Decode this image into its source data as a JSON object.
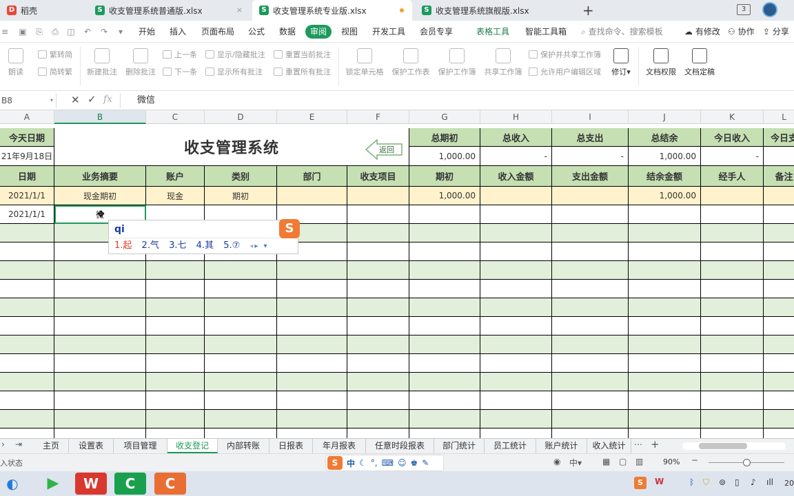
{
  "tabs": {
    "home": "稻壳",
    "file1": "收支管理系统普通版.xlsx",
    "file2": "收支管理系统专业版.xlsx",
    "file3": "收支管理系统旗舰版.xlsx",
    "new_tab": "+",
    "window_count": "3"
  },
  "menu": {
    "items": [
      "开始",
      "插入",
      "页面布局",
      "公式",
      "数据",
      "审阅",
      "视图",
      "开发工具",
      "会员专享",
      "表格工具",
      "智能工具箱"
    ],
    "search": "查找命令、搜索模板",
    "edits": "有修改",
    "collab": "协作",
    "share": "分享"
  },
  "ribbon": {
    "read_aloud": "朗读",
    "trad_to_simp": "繁转简",
    "simp_to_trad": "简转繁",
    "new_comment": "新建批注",
    "delete_comment": "删除批注",
    "prev": "上一条",
    "next": "下一条",
    "toggle_comments": "显示/隐藏批注",
    "show_all_comments": "显示所有批注",
    "reset_current": "重置当前批注",
    "reset_all": "重置所有批注",
    "lock_cell": "锁定单元格",
    "protect_sheet": "保护工作表",
    "protect_book": "保护工作簿",
    "share_book": "共享工作簿",
    "protect_share": "保护并共享工作簿",
    "allow_edit": "允许用户编辑区域",
    "track": "修订",
    "doc_perm": "文档权限",
    "doc_final": "文档定稿"
  },
  "formula": {
    "cell_ref": "B8",
    "content": "微信"
  },
  "columns": [
    "A",
    "B",
    "C",
    "D",
    "E",
    "F",
    "G",
    "H",
    "I",
    "J",
    "K",
    "L"
  ],
  "sheet": {
    "today_label": "今天日期",
    "today_value": "21年9月18日",
    "title": "收支管理系统",
    "back_button": "返回",
    "summary_labels": [
      "总期初",
      "总收入",
      "总支出",
      "总结余",
      "今日收入",
      "今日支"
    ],
    "summary_values": [
      "1,000.00",
      "-",
      "-",
      "1,000.00",
      "-",
      ""
    ],
    "headers": [
      "日期",
      "业务摘要",
      "账户",
      "类别",
      "部门",
      "收支项目",
      "期初",
      "收入金额",
      "支出金额",
      "结余金额",
      "经手人",
      "备注"
    ],
    "row1": [
      "2021/1/1",
      "现金期初",
      "现金",
      "期初",
      "",
      "",
      "1,000.00",
      "",
      "",
      "1,000.00",
      "",
      ""
    ],
    "row2": [
      "2021/1/1",
      "微",
      "",
      "",
      "",
      "",
      "",
      "",
      "",
      "",
      "",
      ""
    ]
  },
  "ime": {
    "input": "qi",
    "candidates": [
      "1.起",
      "2.气",
      "3.七",
      "4.其",
      "5.⑦"
    ],
    "logo": "S"
  },
  "sheet_tabs": [
    "主页",
    "设置表",
    "项目管理",
    "收支登记",
    "内部转账",
    "日报表",
    "年月报表",
    "任意时段报表",
    "部门统计",
    "员工统计",
    "账户统计",
    "收入统计"
  ],
  "active_sheet": "收支登记",
  "status": {
    "mode": "入状态",
    "ime_zh": "中",
    "zoom": "90%",
    "clock": "20"
  },
  "colors": {
    "accent": "#1d9a5c",
    "header_fill": "#c6e0b4",
    "band_fill": "#e2efda",
    "highlight_row": "#fff2cc"
  }
}
